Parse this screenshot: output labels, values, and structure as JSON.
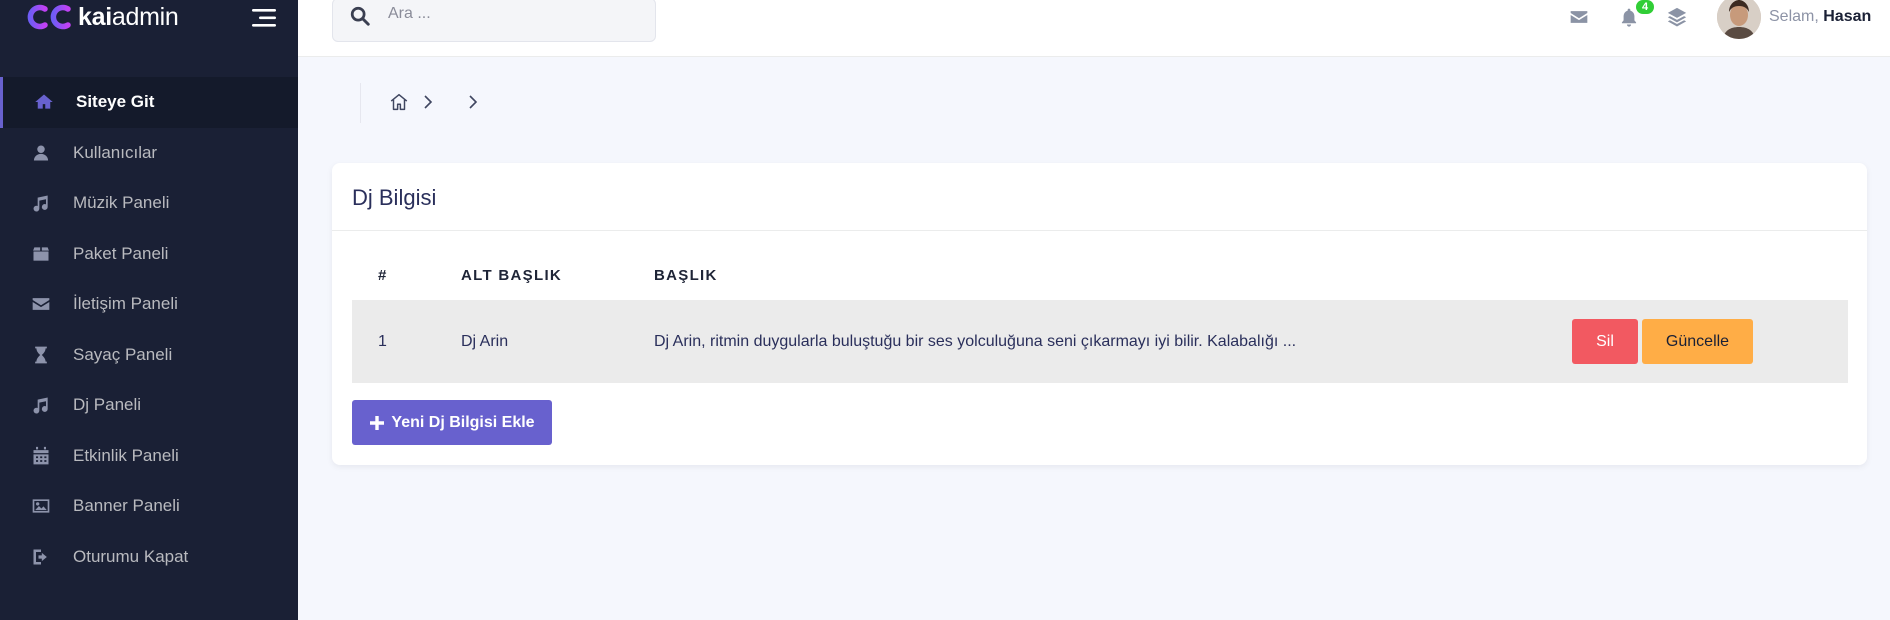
{
  "brand": {
    "name_bold": "kai",
    "name_light": "admin"
  },
  "sidebar": {
    "items": [
      {
        "label": "Siteye Git",
        "icon": "home-icon",
        "active": true
      },
      {
        "label": "Kullanıcılar",
        "icon": "user-icon"
      },
      {
        "label": "Müzik Paneli",
        "icon": "music-icon"
      },
      {
        "label": "Paket Paneli",
        "icon": "box-icon"
      },
      {
        "label": "İletişim Paneli",
        "icon": "envelope-icon"
      },
      {
        "label": "Sayaç Paneli",
        "icon": "hourglass-icon"
      },
      {
        "label": "Dj Paneli",
        "icon": "music-icon"
      },
      {
        "label": "Etkinlik Paneli",
        "icon": "calendar-icon"
      },
      {
        "label": "Banner Paneli",
        "icon": "image-icon"
      },
      {
        "label": "Oturumu Kapat",
        "icon": "sign-out-icon"
      }
    ]
  },
  "search": {
    "placeholder": "Ara ..."
  },
  "header": {
    "notification_count": "4",
    "greeting": "Selam,",
    "user_name": "Hasan"
  },
  "card": {
    "title": "Dj Bilgisi",
    "columns": [
      "#",
      "ALT BAŞLIK",
      "BAŞLIK"
    ],
    "rows": [
      {
        "index": "1",
        "subtitle": "Dj Arin",
        "title": "Dj Arin, ritmin duygularla buluştuğu bir ses yolculuğuna seni çıkarmayı iyi bilir. Kalabalığı ..."
      }
    ],
    "delete_label": "Sil",
    "update_label": "Güncelle",
    "add_label": "Yeni Dj Bilgisi Ekle"
  },
  "colors": {
    "sidebar_bg": "#1a2035",
    "accent": "#6861ce",
    "danger": "#f25961",
    "warning": "#ffad46",
    "success": "#31ce36"
  }
}
